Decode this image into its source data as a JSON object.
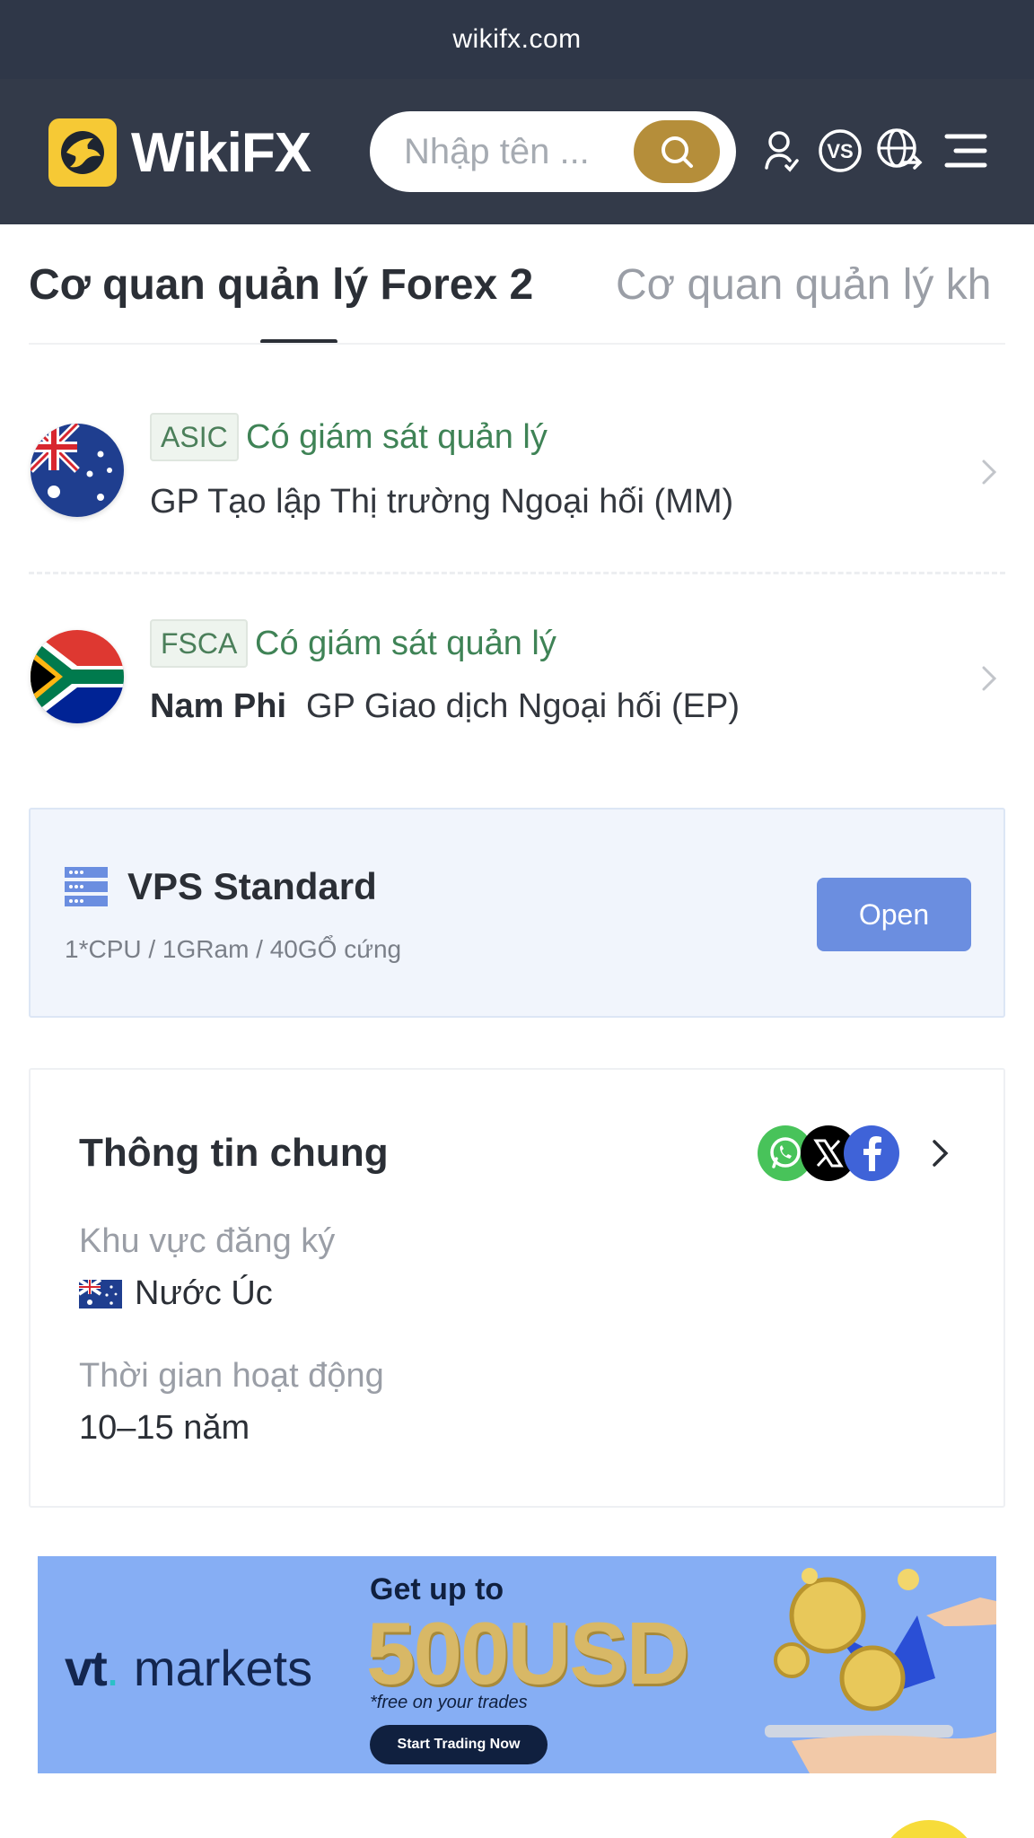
{
  "browser": {
    "url": "wikifx.com"
  },
  "header": {
    "brand": "WikiFX",
    "search_placeholder": "Nhập tên ...",
    "icons": [
      "user-icon",
      "vs-icon",
      "globe-icon",
      "menu-icon"
    ]
  },
  "tabs": [
    {
      "label": "Cơ quan quản lý Forex 2",
      "active": true
    },
    {
      "label": "Cơ quan quản lý kh",
      "active": false
    }
  ],
  "regulators": [
    {
      "badge": "ASIC",
      "status": "Có giám sát quản lý",
      "country": "",
      "license": "GP Tạo lập Thị trường Ngoại hối (MM)",
      "flag": "australia-flag"
    },
    {
      "badge": "FSCA",
      "status": "Có giám sát quản lý",
      "country": "Nam Phi",
      "license": "GP Giao dịch Ngoại hối (EP)",
      "flag": "south-africa-flag"
    }
  ],
  "vps": {
    "title": "VPS Standard",
    "spec": "1*CPU / 1GRam / 40GỔ cứng",
    "button": "Open"
  },
  "general_info": {
    "title": "Thông tin chung",
    "region_label": "Khu vực đăng ký",
    "region_value": "Nước Úc",
    "operating_label": "Thời gian hoạt động",
    "operating_value": "10–15 năm"
  },
  "banner": {
    "brand_a": "vt",
    "brand_b": "markets",
    "headline": "Get up to",
    "amount": "500USD",
    "note": "*free on your trades",
    "cta": "Start Trading Now"
  },
  "colors": {
    "header_bg": "#333a49",
    "accent_gold": "#b58e3a",
    "regulated_green": "#3f8356",
    "open_button": "#6b8ee0"
  }
}
